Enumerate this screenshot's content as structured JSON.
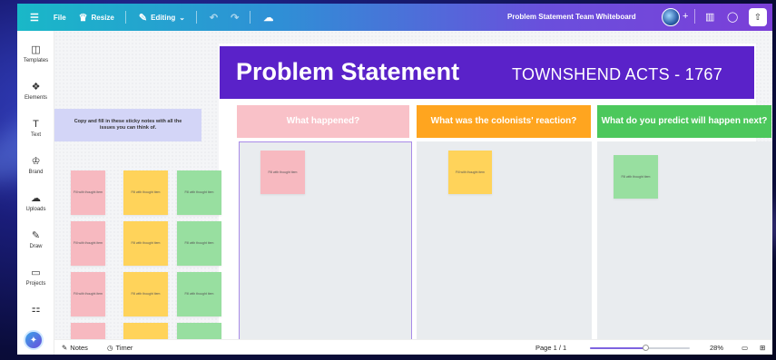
{
  "topbar": {
    "menu_icon": "menu-icon",
    "file_label": "File",
    "resize_label": "Resize",
    "editing_label": "Editing",
    "doc_title": "Problem Statement Team Whiteboard"
  },
  "sidebar": {
    "items": [
      {
        "label": "Templates",
        "icon": "templates-icon",
        "glyph": "◫"
      },
      {
        "label": "Elements",
        "icon": "elements-icon",
        "glyph": "❖"
      },
      {
        "label": "Text",
        "icon": "text-icon",
        "glyph": "T"
      },
      {
        "label": "Brand",
        "icon": "brand-icon",
        "glyph": "♔"
      },
      {
        "label": "Uploads",
        "icon": "uploads-icon",
        "glyph": "☁"
      },
      {
        "label": "Draw",
        "icon": "draw-icon",
        "glyph": "✎"
      },
      {
        "label": "Projects",
        "icon": "projects-icon",
        "glyph": "▭"
      },
      {
        "label": "",
        "icon": "apps-icon",
        "glyph": "⚏"
      }
    ]
  },
  "board": {
    "title": "Problem Statement",
    "subtitle": "TOWNSHEND ACTS - 1767",
    "instructions": "Copy and fill in these sticky notes with all the issues you can think of.",
    "columns": [
      {
        "label": "What happened?",
        "color": "#f9c1c8"
      },
      {
        "label": "What was the colonists' reaction?",
        "color": "#ffa51f"
      },
      {
        "label": "What do you predict will happen next?",
        "color": "#4cc85c"
      }
    ],
    "sticky_text": "Fill with thought item"
  },
  "bottombar": {
    "notes_label": "Notes",
    "timer_label": "Timer",
    "page_label": "Page 1 / 1",
    "zoom_label": "28%",
    "zoom_value": 0.55
  },
  "colors": {
    "banner": "#5a22c9",
    "pink": "#f7b9c0",
    "yellow": "#ffd35a",
    "green": "#98dfa0"
  }
}
